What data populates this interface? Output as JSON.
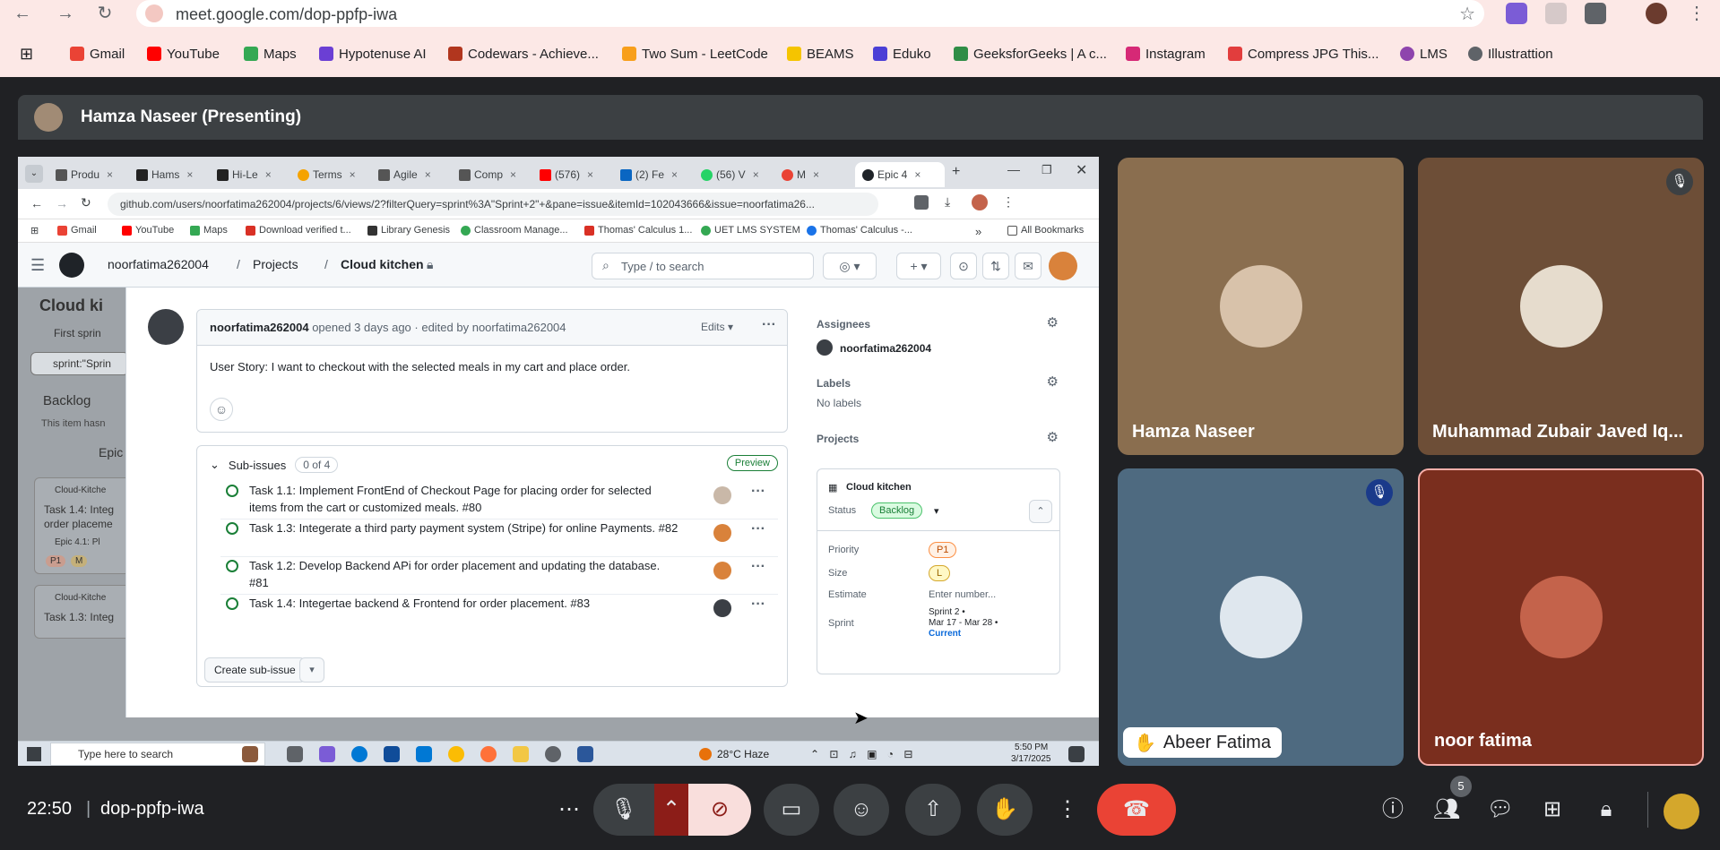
{
  "browser": {
    "url": "meet.google.com/dop-ppfp-iwa",
    "bookmarks": [
      {
        "label": "Gmail",
        "color": "#ea4335"
      },
      {
        "label": "YouTube",
        "color": "#ff0000"
      },
      {
        "label": "Maps",
        "color": "#34a853"
      },
      {
        "label": "Hypotenuse AI",
        "color": "#6b3fd4"
      },
      {
        "label": "Codewars - Achieve...",
        "color": "#b1361e"
      },
      {
        "label": "Two Sum - LeetCode",
        "color": "#f89f1b"
      },
      {
        "label": "BEAMS",
        "color": "#f5c400"
      },
      {
        "label": "Eduko",
        "color": "#4b3fd6"
      },
      {
        "label": "GeeksforGeeks | A c...",
        "color": "#2f8d46"
      },
      {
        "label": "Instagram",
        "color": "#d62976"
      },
      {
        "label": "Compress JPG This...",
        "color": "#e23d3d"
      },
      {
        "label": "LMS",
        "color": "#8e44ad"
      },
      {
        "label": "Illustrattion",
        "color": "#5f6368"
      }
    ]
  },
  "presenter": {
    "label": "Hamza Naseer (Presenting)"
  },
  "shared": {
    "tabs": [
      "Produ",
      "Hams",
      "Hi-Le",
      "Terms",
      "Agile",
      "Comp",
      "(576)",
      "(2) Fe",
      "(56) V",
      "M",
      "Epic 4"
    ],
    "url": "github.com/users/noorfatima262004/projects/6/views/2?filterQuery=sprint%3A\"Sprint+2\"+&pane=issue&itemId=102043666&issue=noorfatima26...",
    "bookmarks": [
      "Gmail",
      "YouTube",
      "Maps",
      "Download verified t...",
      "Library Genesis",
      "Classroom Manage...",
      "Thomas' Calculus 1...",
      "UET LMS SYSTEM",
      "Thomas' Calculus -...",
      "All Bookmarks"
    ],
    "breadcrumb": {
      "user": "noorfatima262004",
      "sep1": "/",
      "projects": "Projects",
      "sep2": "/",
      "project": "Cloud kitchen"
    },
    "search_placeholder": "Type / to search",
    "bg": {
      "title": "Cloud ki",
      "view": "First sprin",
      "filter": "sprint:\"Sprin",
      "backlog": "Backlog",
      "backlog_note": "This item hasn",
      "epic": "Epic",
      "card1_repo": "Cloud-Kitche",
      "card1_title": "Task 1.4: Integ",
      "card1_title2": "order placeme",
      "card1_epic": "Epic 4.1: Pl",
      "card1_p": "P1",
      "card1_s": "M",
      "card2_repo": "Cloud-Kitche",
      "card2_title": "Task 1.3: Integ"
    },
    "comment": {
      "author": "noorfatima262004",
      "meta": "opened 3 days ago · edited by noorfatima262004",
      "edits": "Edits",
      "body": "User Story: I want to checkout with the selected meals in my cart and place order."
    },
    "subissues": {
      "title": "Sub-issues",
      "count": "0 of 4",
      "preview": "Preview",
      "items": [
        {
          "text": "Task 1.1: Implement FrontEnd of Checkout Page for placing order for selected items from the cart or customized meals. #80",
          "avatar": "#c9b8a8"
        },
        {
          "text": "Task 1.3: Integerate a third party payment system (Stripe) for online Payments. #82",
          "avatar": "#d9823b"
        },
        {
          "text": "Task 1.2: Develop Backend APi for order placement and updating the database. #81",
          "avatar": "#d9823b"
        },
        {
          "text": "Task 1.4: Integertae backend & Frontend for order placement. #83",
          "avatar": "#3b3f45"
        }
      ],
      "create": "Create sub-issue"
    },
    "sidebar": {
      "assignees": "Assignees",
      "assignee": "noorfatima262004",
      "labels": "Labels",
      "no_labels": "No labels",
      "projects": "Projects",
      "project_name": "Cloud kitchen",
      "status_label": "Status",
      "status": "Backlog",
      "priority_label": "Priority",
      "priority": "P1",
      "size_label": "Size",
      "size": "L",
      "estimate_label": "Estimate",
      "estimate_placeholder": "Enter number...",
      "sprint_label": "Sprint",
      "sprint": "Sprint 2 •",
      "sprint_dates": "Mar 17 - Mar 28 •",
      "sprint_current": "Current"
    },
    "taskbar": {
      "search": "Type here to search",
      "weather": "28°C Haze",
      "time": "5:50 PM",
      "date": "3/17/2025"
    }
  },
  "participants": [
    {
      "name": "Hamza Naseer",
      "bg": "#8a6e4f",
      "avatar": "#d8c2aa"
    },
    {
      "name": "Muhammad Zubair Javed Iq...",
      "bg": "#6d4e37",
      "avatar": "#e6dccd"
    },
    {
      "name": "Abeer Fatima",
      "bg": "#4e6a80",
      "avatar": "#dfe7ee"
    },
    {
      "name": "noor fatima",
      "bg": "#7a2e1e",
      "avatar": "#c4634b"
    }
  ],
  "meet": {
    "time": "22:50",
    "separator": "|",
    "code": "dop-ppfp-iwa",
    "participant_count": "5"
  }
}
